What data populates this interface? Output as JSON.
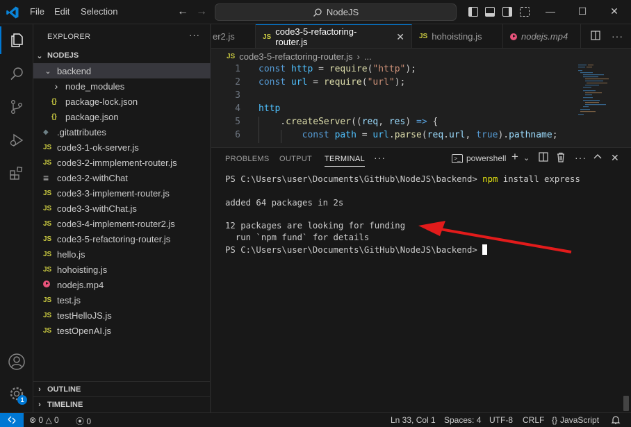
{
  "titlebar": {
    "menu": [
      "File",
      "Edit",
      "Selection"
    ],
    "search_text": "NodeJS",
    "back": "←",
    "forward": "→",
    "minimize": "—",
    "maximize": "☐",
    "close": "✕"
  },
  "activity": {
    "accounts_badge": "1"
  },
  "sidebar": {
    "title": "EXPLORER",
    "more": "···",
    "root": "NODEJS",
    "tree": [
      {
        "label": "backend",
        "type": "folder-open",
        "depth": 1,
        "selected": true
      },
      {
        "label": "node_modules",
        "type": "folder-closed",
        "depth": 2
      },
      {
        "label": "package-lock.json",
        "type": "json",
        "depth": 2
      },
      {
        "label": "package.json",
        "type": "json",
        "depth": 2
      },
      {
        "label": ".gitattributes",
        "type": "git",
        "depth": 1
      },
      {
        "label": "code3-1-ok-server.js",
        "type": "js",
        "depth": 1
      },
      {
        "label": "code3-2-immplement-router.js",
        "type": "js",
        "depth": 1
      },
      {
        "label": "code3-2-withChat",
        "type": "text",
        "depth": 1
      },
      {
        "label": "code3-3-implement-router.js",
        "type": "js",
        "depth": 1
      },
      {
        "label": "code3-3-withChat.js",
        "type": "js",
        "depth": 1
      },
      {
        "label": "code3-4-implement-router2.js",
        "type": "js",
        "depth": 1
      },
      {
        "label": "code3-5-refactoring-router.js",
        "type": "js",
        "depth": 1
      },
      {
        "label": "hello.js",
        "type": "js",
        "depth": 1
      },
      {
        "label": "hohoisting.js",
        "type": "js",
        "depth": 1
      },
      {
        "label": "nodejs.mp4",
        "type": "media",
        "depth": 1
      },
      {
        "label": "test.js",
        "type": "js",
        "depth": 1
      },
      {
        "label": "testHelloJS.js",
        "type": "js",
        "depth": 1
      },
      {
        "label": "testOpenAI.js",
        "type": "js",
        "depth": 1
      }
    ],
    "outline": "OUTLINE",
    "timeline": "TIMELINE"
  },
  "tabs": [
    {
      "label": "er2.js",
      "icon": "",
      "active": false
    },
    {
      "label": "code3-5-refactoring-router.js",
      "icon": "JS",
      "active": true
    },
    {
      "label": "hohoisting.js",
      "icon": "JS",
      "active": false
    },
    {
      "label": "nodejs.mp4",
      "icon": "media",
      "active": false
    }
  ],
  "tab_close": "✕",
  "breadcrumb": {
    "file": "code3-5-refactoring-router.js",
    "sep": "›",
    "rest": "..."
  },
  "editor": {
    "line_numbers": [
      "1",
      "2",
      "3",
      "4",
      "5",
      "6"
    ],
    "lines": [
      [
        [
          "kw",
          "const "
        ],
        [
          "var",
          "http"
        ],
        [
          "plain",
          " = "
        ],
        [
          "fn",
          "require"
        ],
        [
          "plain",
          "("
        ],
        [
          "str",
          "\"http\""
        ],
        [
          "plain",
          ");"
        ]
      ],
      [
        [
          "kw",
          "const "
        ],
        [
          "var",
          "url"
        ],
        [
          "plain",
          " = "
        ],
        [
          "fn",
          "require"
        ],
        [
          "plain",
          "("
        ],
        [
          "str",
          "\"url\""
        ],
        [
          "plain",
          ");"
        ]
      ],
      [],
      [
        [
          "var",
          "http"
        ]
      ],
      [
        [
          "plain",
          "    ."
        ],
        [
          "fn",
          "createServer"
        ],
        [
          "plain",
          "(("
        ],
        [
          "prm",
          "req"
        ],
        [
          "plain",
          ", "
        ],
        [
          "prm",
          "res"
        ],
        [
          "plain",
          ") "
        ],
        [
          "kw",
          "=>"
        ],
        [
          "plain",
          " {"
        ]
      ],
      [
        [
          "plain",
          "        "
        ],
        [
          "kw",
          "const "
        ],
        [
          "var",
          "path"
        ],
        [
          "plain",
          " = "
        ],
        [
          "var",
          "url"
        ],
        [
          "plain",
          "."
        ],
        [
          "fn",
          "parse"
        ],
        [
          "plain",
          "("
        ],
        [
          "prm",
          "req"
        ],
        [
          "plain",
          "."
        ],
        [
          "prop",
          "url"
        ],
        [
          "plain",
          ", "
        ],
        [
          "kw",
          "true"
        ],
        [
          "plain",
          ")."
        ],
        [
          "prop",
          "pathname"
        ],
        [
          "plain",
          ";"
        ]
      ]
    ]
  },
  "panel": {
    "tabs": [
      "PROBLEMS",
      "OUTPUT",
      "TERMINAL"
    ],
    "more": "···",
    "profile": "powershell",
    "terminal_lines": [
      {
        "prompt": "PS C:\\Users\\user\\Documents\\GitHub\\NodeJS\\backend> ",
        "cmd": "npm",
        "args": " install express"
      },
      {
        "text": ""
      },
      {
        "text": "added 64 packages in 2s"
      },
      {
        "text": ""
      },
      {
        "text": "12 packages are looking for funding"
      },
      {
        "text": "  run `npm fund` for details"
      },
      {
        "prompt": "PS C:\\Users\\user\\Documents\\GitHub\\NodeJS\\backend> ",
        "cursor": true
      }
    ]
  },
  "annotation": {
    "color": "#e21b1b"
  },
  "statusbar": {
    "errors": "0",
    "warnings": "0",
    "ports": "0",
    "position": "Ln 33, Col 1",
    "spaces": "Spaces: 4",
    "encoding": "UTF-8",
    "eol": "CRLF",
    "language": "JavaScript"
  },
  "colors": {
    "accent": "#0078d4",
    "js": "#cbcb41",
    "media": "#e8537b"
  }
}
